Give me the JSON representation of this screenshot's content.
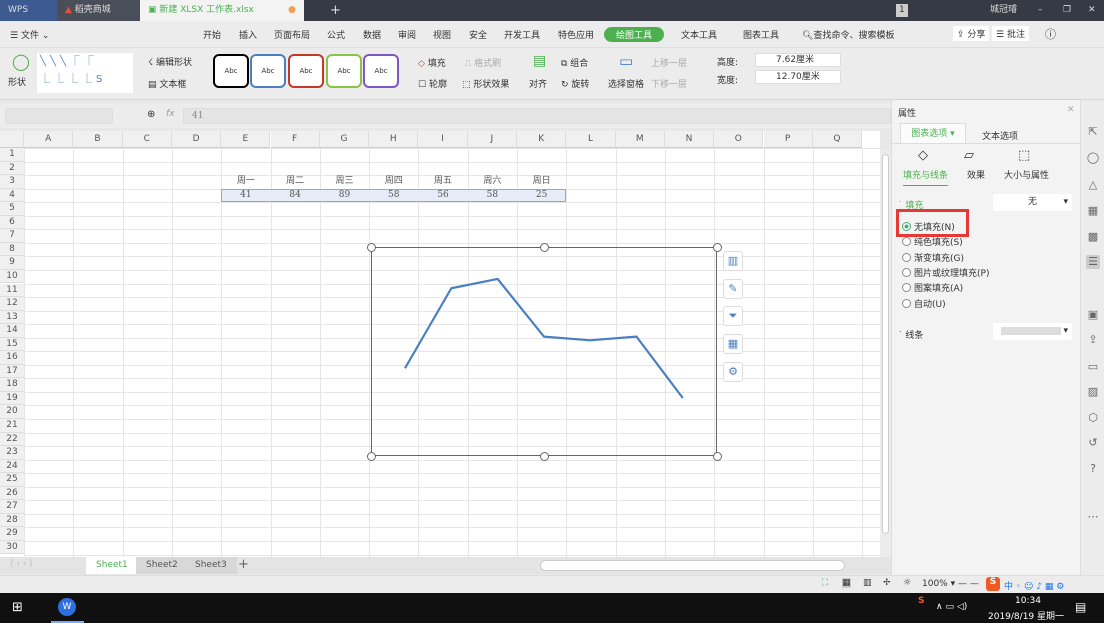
{
  "tabs": [
    {
      "label": "WPS"
    },
    {
      "label": "稻壳商城"
    },
    {
      "label": "新建 XLSX 工作表.xlsx"
    }
  ],
  "titlebar": {
    "badge": "1",
    "user": "城冠璿"
  },
  "menu": {
    "file": "文件",
    "items": [
      "开始",
      "插入",
      "页面布局",
      "公式",
      "数据",
      "审阅",
      "视图",
      "安全",
      "开发工具",
      "特色应用",
      "绘图工具",
      "文本工具",
      "图表工具"
    ],
    "active": "绘图工具",
    "search": "查找命令、搜索模板",
    "share": "分享",
    "comment": "批注"
  },
  "ribbon": {
    "shape": "形状",
    "edit_shape": "编辑形状",
    "textbox": "文本框",
    "style_label": "Abc",
    "style_colors": [
      "#000000",
      "#4a7fc1",
      "#c0392b",
      "#8bc34a",
      "#7e57c2"
    ],
    "fill": "填充",
    "outline": "轮廓",
    "format_painter": "格式刷",
    "shape_effect": "形状效果",
    "align": "对齐",
    "group": "组合",
    "rotate": "旋转",
    "selection_pane": "选择窗格",
    "bring_forward": "上移一层",
    "send_backward": "下移一层",
    "height_label": "高度:",
    "height_value": "7.62厘米",
    "width_label": "宽度:",
    "width_value": "12.70厘米"
  },
  "formula_bar": {
    "fx": "fx",
    "value": "41"
  },
  "columns": [
    "A",
    "B",
    "C",
    "D",
    "E",
    "F",
    "G",
    "H",
    "I",
    "J",
    "K",
    "L",
    "M",
    "N",
    "O",
    "P",
    "Q"
  ],
  "rows": [
    "1",
    "2",
    "3",
    "4",
    "5",
    "6",
    "7",
    "8",
    "9",
    "10",
    "11",
    "12",
    "13",
    "14",
    "15",
    "16",
    "17",
    "18",
    "19",
    "20",
    "21",
    "22",
    "23",
    "24",
    "25",
    "26",
    "27",
    "28",
    "29",
    "30"
  ],
  "table": {
    "headers": [
      "周一",
      "周二",
      "周三",
      "周四",
      "周五",
      "周六",
      "周日"
    ],
    "values": [
      "41",
      "84",
      "89",
      "58",
      "56",
      "58",
      "25"
    ]
  },
  "chart_data": {
    "type": "line",
    "categories": [
      "周一",
      "周二",
      "周三",
      "周四",
      "周五",
      "周六",
      "周日"
    ],
    "values": [
      41,
      84,
      89,
      58,
      56,
      58,
      25
    ],
    "ylim": [
      0,
      100
    ],
    "color": "#4a7fc1",
    "grid": false,
    "legend": "none"
  },
  "chart_tools": [
    "chart-elements-icon",
    "chart-style-icon",
    "chart-filter-icon",
    "chart-layout-icon",
    "chart-settings-icon"
  ],
  "panel": {
    "title": "属性",
    "tab_chart": "图表选项",
    "tab_text": "文本选项",
    "sub_fill_line": "填充与线条",
    "sub_effect": "效果",
    "sub_size": "大小与属性",
    "fill_section": "填充",
    "fill_value": "无",
    "options": [
      "无填充(N)",
      "纯色填充(S)",
      "渐变填充(G)",
      "图片或纹理填充(P)",
      "图案填充(A)",
      "自动(U)"
    ],
    "selected": "无填充(N)",
    "line_section": "线条",
    "highlight_color": "#e53935"
  },
  "sheets": [
    "Sheet1",
    "Sheet2",
    "Sheet3"
  ],
  "active_sheet": "Sheet1",
  "status": {
    "zoom": "100%"
  },
  "taskbar": {
    "time": "10:34",
    "date": "2019/8/19 星期一"
  }
}
